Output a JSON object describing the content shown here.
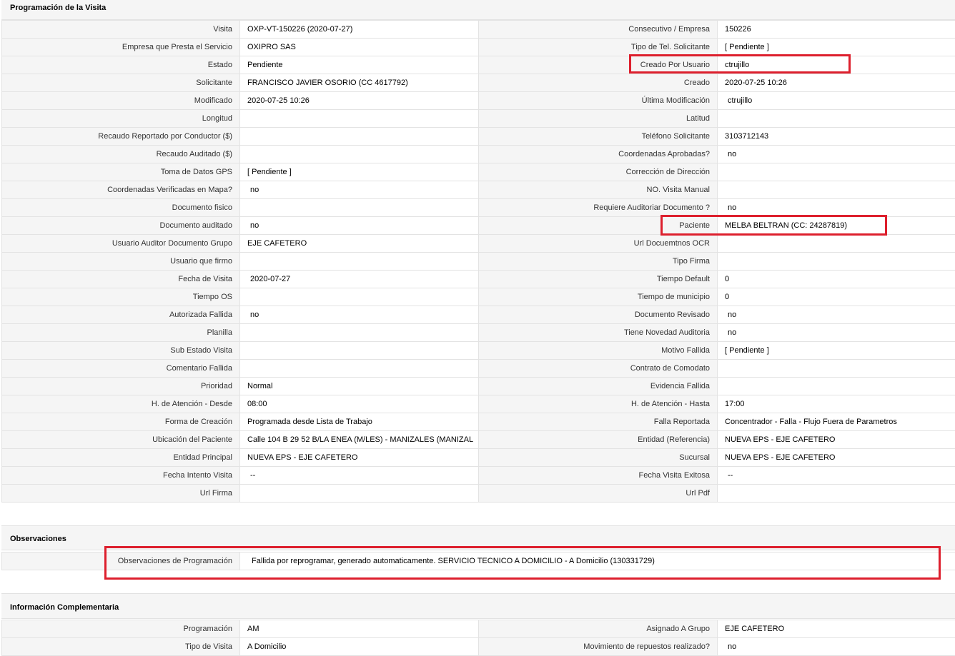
{
  "sections": {
    "programacion": {
      "title": "Programación de la Visita"
    },
    "observaciones": {
      "title": "Observaciones"
    },
    "complementaria": {
      "title": "Información Complementaria"
    }
  },
  "programacion_rows": [
    {
      "l1": "Visita",
      "v1": "OXP-VT-150226 (2020-07-27)",
      "l2": "Consecutivo / Empresa",
      "v2": "150226"
    },
    {
      "l1": "Empresa que Presta el Servicio",
      "v1": "OXIPRO SAS",
      "l2": "Tipo de Tel. Solicitante",
      "v2": "[ Pendiente ]"
    },
    {
      "l1": "Estado",
      "v1": "Pendiente",
      "l2": "Creado Por Usuario",
      "v2": "ctrujillo"
    },
    {
      "l1": "Solicitante",
      "v1": "FRANCISCO JAVIER OSORIO (CC 4617792)",
      "l2": "Creado",
      "v2": "2020-07-25 10:26"
    },
    {
      "l1": "Modificado",
      "v1": "2020-07-25 10:26",
      "l2": "Última Modificación",
      "v2": "ctrujillo"
    },
    {
      "l1": "Longitud",
      "v1": "",
      "l2": "Latitud",
      "v2": ""
    },
    {
      "l1": "Recaudo Reportado por Conductor ($)",
      "v1": "",
      "l2": "Teléfono Solicitante",
      "v2": "3103712143"
    },
    {
      "l1": "Recaudo Auditado ($)",
      "v1": "",
      "l2": "Coordenadas Aprobadas?",
      "v2": "no"
    },
    {
      "l1": "Toma de Datos GPS",
      "v1": "[ Pendiente ]",
      "l2": "Corrección de Dirección",
      "v2": ""
    },
    {
      "l1": "Coordenadas Verificadas en Mapa?",
      "v1": "no",
      "l2": "NO. Visita Manual",
      "v2": ""
    },
    {
      "l1": "Documento fisico",
      "v1": "",
      "l2": "Requiere Auditoriar Documento ?",
      "v2": "no"
    },
    {
      "l1": "Documento auditado",
      "v1": "no",
      "l2": "Paciente",
      "v2": "MELBA BELTRAN (CC: 24287819)"
    },
    {
      "l1": "Usuario Auditor Documento Grupo",
      "v1": "EJE CAFETERO",
      "l2": "Url Docuemtnos OCR",
      "v2": ""
    },
    {
      "l1": "Usuario que firmo",
      "v1": "",
      "l2": "Tipo Firma",
      "v2": ""
    },
    {
      "l1": "Fecha de Visita",
      "v1": "2020-07-27",
      "l2": "Tiempo Default",
      "v2": "0"
    },
    {
      "l1": "Tiempo OS",
      "v1": "",
      "l2": "Tiempo de municipio",
      "v2": "0"
    },
    {
      "l1": "Autorizada Fallida",
      "v1": "no",
      "l2": "Documento Revisado",
      "v2": "no"
    },
    {
      "l1": "Planilla",
      "v1": "",
      "l2": "Tiene Novedad Auditoria",
      "v2": "no"
    },
    {
      "l1": "Sub Estado Visita",
      "v1": "",
      "l2": "Motivo Fallida",
      "v2": "[ Pendiente ]"
    },
    {
      "l1": "Comentario Fallida",
      "v1": "",
      "l2": "Contrato de Comodato",
      "v2": ""
    },
    {
      "l1": "Prioridad",
      "v1": "Normal",
      "l2": "Evidencia Fallida",
      "v2": ""
    },
    {
      "l1": "H. de Atención - Desde",
      "v1": "08:00",
      "l2": "H. de Atención - Hasta",
      "v2": "17:00"
    },
    {
      "l1": "Forma de Creación",
      "v1": "Programada desde Lista de Trabajo",
      "l2": "Falla Reportada",
      "v2": "Concentrador - Falla - Flujo Fuera de Parametros"
    },
    {
      "l1": "Ubicación del Paciente",
      "v1": "Calle 104 B 29 52 B/LA ENEA (M/LES) - MANIZALES (MANIZAL",
      "l2": "Entidad (Referencia)",
      "v2": "NUEVA EPS - EJE CAFETERO"
    },
    {
      "l1": "Entidad Principal",
      "v1": "NUEVA EPS - EJE CAFETERO",
      "l2": "Sucursal",
      "v2": "NUEVA EPS - EJE CAFETERO"
    },
    {
      "l1": "Fecha Intento Visita",
      "v1": "--",
      "l2": "Fecha Visita Exitosa",
      "v2": "--"
    },
    {
      "l1": "Url Firma",
      "v1": "",
      "l2": "Url Pdf",
      "v2": ""
    }
  ],
  "observaciones": {
    "label": "Observaciones de Programación",
    "value": "Fallida por reprogramar, generado automaticamente. SERVICIO TECNICO A DOMICILIO - A Domicilio (130331729)"
  },
  "complementaria_rows": [
    {
      "l1": "Programación",
      "v1": "AM",
      "l2": "Asignado A Grupo",
      "v2": "EJE CAFETERO"
    },
    {
      "l1": "Tipo de Visita",
      "v1": "A Domicilio",
      "l2": "Movimiento de repuestos realizado?",
      "v2": "no"
    }
  ],
  "colors": {
    "highlight": "#dd1f2d",
    "label_bg": "#f5f5f5",
    "border": "#e3e3e3"
  }
}
